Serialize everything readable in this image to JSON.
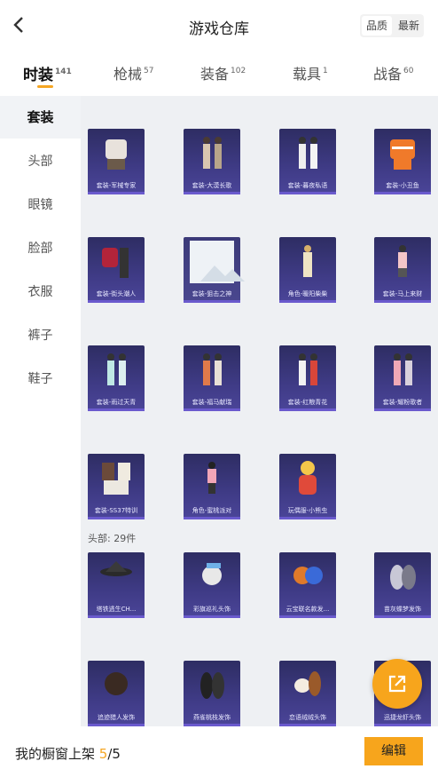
{
  "header": {
    "title": "游戏仓库",
    "sort_options": [
      "品质",
      "最新"
    ]
  },
  "tabs": [
    {
      "label": "时装",
      "count": "141"
    },
    {
      "label": "枪械",
      "count": "57"
    },
    {
      "label": "装备",
      "count": "102"
    },
    {
      "label": "载具",
      "count": "1"
    },
    {
      "label": "战备",
      "count": "60"
    }
  ],
  "sidebar": {
    "items": [
      "套装",
      "头部",
      "眼镜",
      "脸部",
      "衣服",
      "裤子",
      "鞋子"
    ]
  },
  "suits": [
    "套装-军械专家",
    "套装-大漠长歌",
    "套装-暮夜私语",
    "套装-小丑鱼",
    "套装-街头潮人",
    "套装-狙击之神",
    "角色-暖阳柴柴",
    "套装-马上来财",
    "套装-雨过天青",
    "套装-福马献瑞",
    "套装-红粮青花",
    "套装-耀粉歌者",
    "套装-SS37特训",
    "角色-蜜桃派对",
    "玩偶服-小熊虫"
  ],
  "head_section": {
    "label": "头部: 29件"
  },
  "heads": [
    "塔铁逃生CH...",
    "彩旗巡礼头饰",
    "云宝联名款发...",
    "苗灰蝶梦发饰",
    "追迹猎人发饰",
    "燕雀桃枝发饰",
    "恋语绒绒头饰",
    "迅捷龙虾头饰"
  ],
  "bottom": {
    "prefix": "我的橱窗上架 ",
    "current": "5",
    "total": "/5",
    "edit_label": "编辑"
  }
}
